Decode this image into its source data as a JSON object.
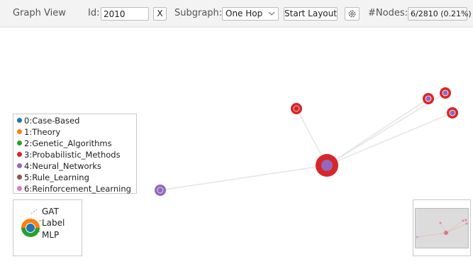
{
  "toolbar": {
    "title": "Graph View",
    "id_label": "Id:",
    "id_value": "2010",
    "clear_label": "X",
    "subgraph_label": "Subgraph:",
    "subgraph_value": "One Hop",
    "start_layout_label": "Start Layout",
    "settings_icon": "gear-icon",
    "nodes_label": "#Nodes:",
    "nodes_value": "6/2810 (0.21%)"
  },
  "legend": {
    "items": [
      {
        "label": "0:Case-Based",
        "color": "#1f77b4"
      },
      {
        "label": "1:Theory",
        "color": "#ff7f0e"
      },
      {
        "label": "2:Genetic_Algorithms",
        "color": "#2ca02c"
      },
      {
        "label": "3:Probabilistic_Methods",
        "color": "#d62728"
      },
      {
        "label": "4:Neural_Networks",
        "color": "#9467bd"
      },
      {
        "label": "5:Rule_Learning",
        "color": "#8c564b"
      },
      {
        "label": "6:Reinforcement_Learning",
        "color": "#e377c2"
      }
    ]
  },
  "shape_legend": {
    "labels": [
      "GAT",
      "Label",
      "MLP"
    ]
  },
  "graph": {
    "center_node_id": "2010",
    "nodes": [
      {
        "role": "center",
        "outer_color": "#d62728",
        "inner_color": "#9467bd"
      },
      {
        "role": "neighbor",
        "outer_color": "#d62728",
        "inner_color": "#d62728"
      },
      {
        "role": "neighbor",
        "outer_color": "#d62728",
        "inner_color": "#9467bd"
      },
      {
        "role": "neighbor",
        "outer_color": "#d62728",
        "inner_color": "#9467bd"
      },
      {
        "role": "neighbor",
        "outer_color": "#d62728",
        "inner_color": "#9467bd"
      },
      {
        "role": "neighbor",
        "outer_color": "#9467bd",
        "inner_color": "#9467bd"
      }
    ]
  },
  "minimap": {
    "viewport": "overview"
  }
}
